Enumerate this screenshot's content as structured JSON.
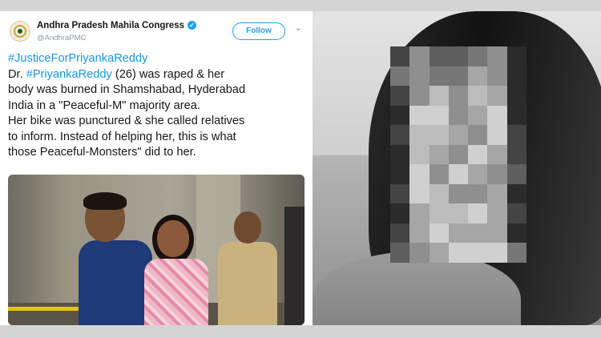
{
  "tweet": {
    "account_name": "Andhra Pradesh Mahila Congress",
    "handle": "@AndhraPMC",
    "verified_glyph": "✓",
    "follow_label": "Follow",
    "menu_glyph": "⌄",
    "lines": [
      {
        "hashtag": "#JusticeForPriyankaReddy",
        "before": "",
        "after": ""
      },
      {
        "before": "Dr. ",
        "hashtag": "#PriyankaReddy",
        "after": " (26) was raped & her"
      },
      {
        "before": "body was burned in Shamshabad, Hyderabad",
        "hashtag": "",
        "after": ""
      },
      {
        "before": "India in a \"Peaceful-M\" majority area.",
        "hashtag": "",
        "after": ""
      },
      {
        "before": "Her bike was punctured & she called relatives",
        "hashtag": "",
        "after": ""
      },
      {
        "before": "to inform. Instead of helping her, this is what",
        "hashtag": "",
        "after": ""
      },
      {
        "before": "those Peaceful-Monsters\" did to her.",
        "hashtag": "",
        "after": ""
      }
    ],
    "colors": {
      "link": "#1b95e0",
      "follow": "#1da1f2"
    }
  },
  "icons": {
    "avatar": "party-logo-icon",
    "verified": "verified-badge-icon",
    "menu": "chevron-down-icon"
  }
}
